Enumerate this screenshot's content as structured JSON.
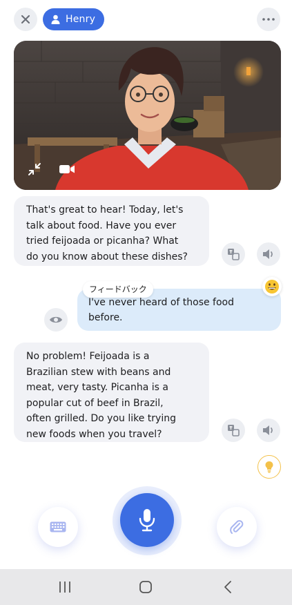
{
  "header": {
    "close_icon": "close-icon",
    "user_name": "Henry",
    "user_icon": "person-icon",
    "more_icon": "more-horizontal-icon"
  },
  "video": {
    "collapse_icon": "collapse-arrows-icon",
    "camera_icon": "video-camera-icon"
  },
  "messages": [
    {
      "role": "assistant",
      "lines": [
        "That's great to hear! Today, let's",
        "talk about food. Have you ever",
        "tried feijoada or picanha? What",
        "do you know about these dishes?"
      ]
    },
    {
      "role": "user",
      "tag": "フィードバック",
      "emoji": "grinning-face-emoji",
      "lines": [
        "I've never heard of those food",
        "before."
      ]
    },
    {
      "role": "assistant",
      "lines": [
        "No problem! Feijoada is a",
        "Brazilian stew with beans and",
        "meat, very tasty. Picanha is a",
        "popular cut of beef in Brazil,",
        "often grilled. Do you like trying",
        "new foods when you travel?"
      ]
    }
  ],
  "actions": {
    "translate_icon": "translate-icon",
    "speaker_icon": "speaker-icon",
    "eye_icon": "eye-icon",
    "hint_icon": "lightbulb-icon"
  },
  "controls": {
    "keyboard_icon": "keyboard-icon",
    "mic_icon": "microphone-icon",
    "attach_icon": "paperclip-icon"
  },
  "colors": {
    "accent": "#3c6de2",
    "bot_bubble": "#f1f2f6",
    "user_bubble": "#dcebfa",
    "hint": "#f3c14a"
  },
  "system_nav": {
    "recents_icon": "recents-icon",
    "home_icon": "home-icon",
    "back_icon": "back-icon"
  }
}
